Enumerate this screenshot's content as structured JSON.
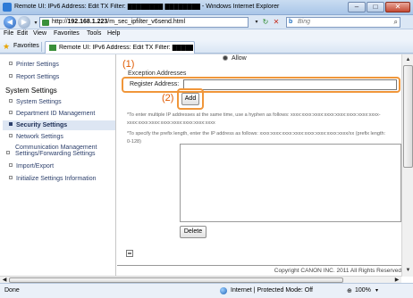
{
  "window": {
    "title": "Remote UI: IPv6 Address: Edit TX Filter: ████████ ████████ - Windows Internet Explorer",
    "minimize": "–",
    "maximize": "□",
    "close": "✕"
  },
  "navbar": {
    "url_prefix": "http://",
    "url_host": "192.168.1.223",
    "url_path": "/m_sec_ipfilter_v6send.html",
    "refresh": "↻",
    "stop": "✕",
    "search_placeholder": "Bing",
    "search_engine_icon": "b",
    "search_icon": "⌕"
  },
  "menubar": {
    "items": [
      "File",
      "Edit",
      "View",
      "Favorites",
      "Tools",
      "Help"
    ]
  },
  "favorites": {
    "label": "Favorites",
    "tab_title": "Remote UI: IPv6 Address: Edit TX Filter: ████████ ..."
  },
  "sidebar": {
    "items_top": [
      "Printer Settings",
      "Report Settings"
    ],
    "heading": "System Settings",
    "items": [
      "System Settings",
      "Department ID Management",
      "Security Settings",
      "Network Settings",
      "Communication Management Settings/Forwarding Settings",
      "Import/Export",
      "Initialize Settings Information"
    ],
    "comm_line1": "Communication Management",
    "comm_line2": "Settings/Forwarding Settings"
  },
  "main": {
    "allow_label": "Allow",
    "section_heading": "Exception Addresses",
    "callout_1": "(1)",
    "callout_2": "(2)",
    "register_label": "Register Address:",
    "register_value": "",
    "add_button": "Add",
    "note1_line1": "*To enter multiple IP addresses at the same time, use a hyphen as follows: xxxx:xxxx:xxxx:xxxx:xxxx:xxxx:xxxx:xxxx-",
    "note1_line2": "xxxx:xxxx:xxxx:xxxx:xxxx:xxxx:xxxx:xxxx",
    "note2_line1": "*To specify the prefix length, enter the IP address as follows: xxxx:xxxx:xxxx:xxxx:xxxx:xxxx:xxxx:xxxx/xx (prefix length:",
    "note2_line2": "0-128)",
    "delete_button": "Delete",
    "copyright": "Copyright CANON INC. 2011 All Rights Reserved"
  },
  "statusbar": {
    "status": "Done",
    "zone": "Internet | Protected Mode: Off",
    "zoom": "100%",
    "zoom_prefix": "⊕"
  }
}
